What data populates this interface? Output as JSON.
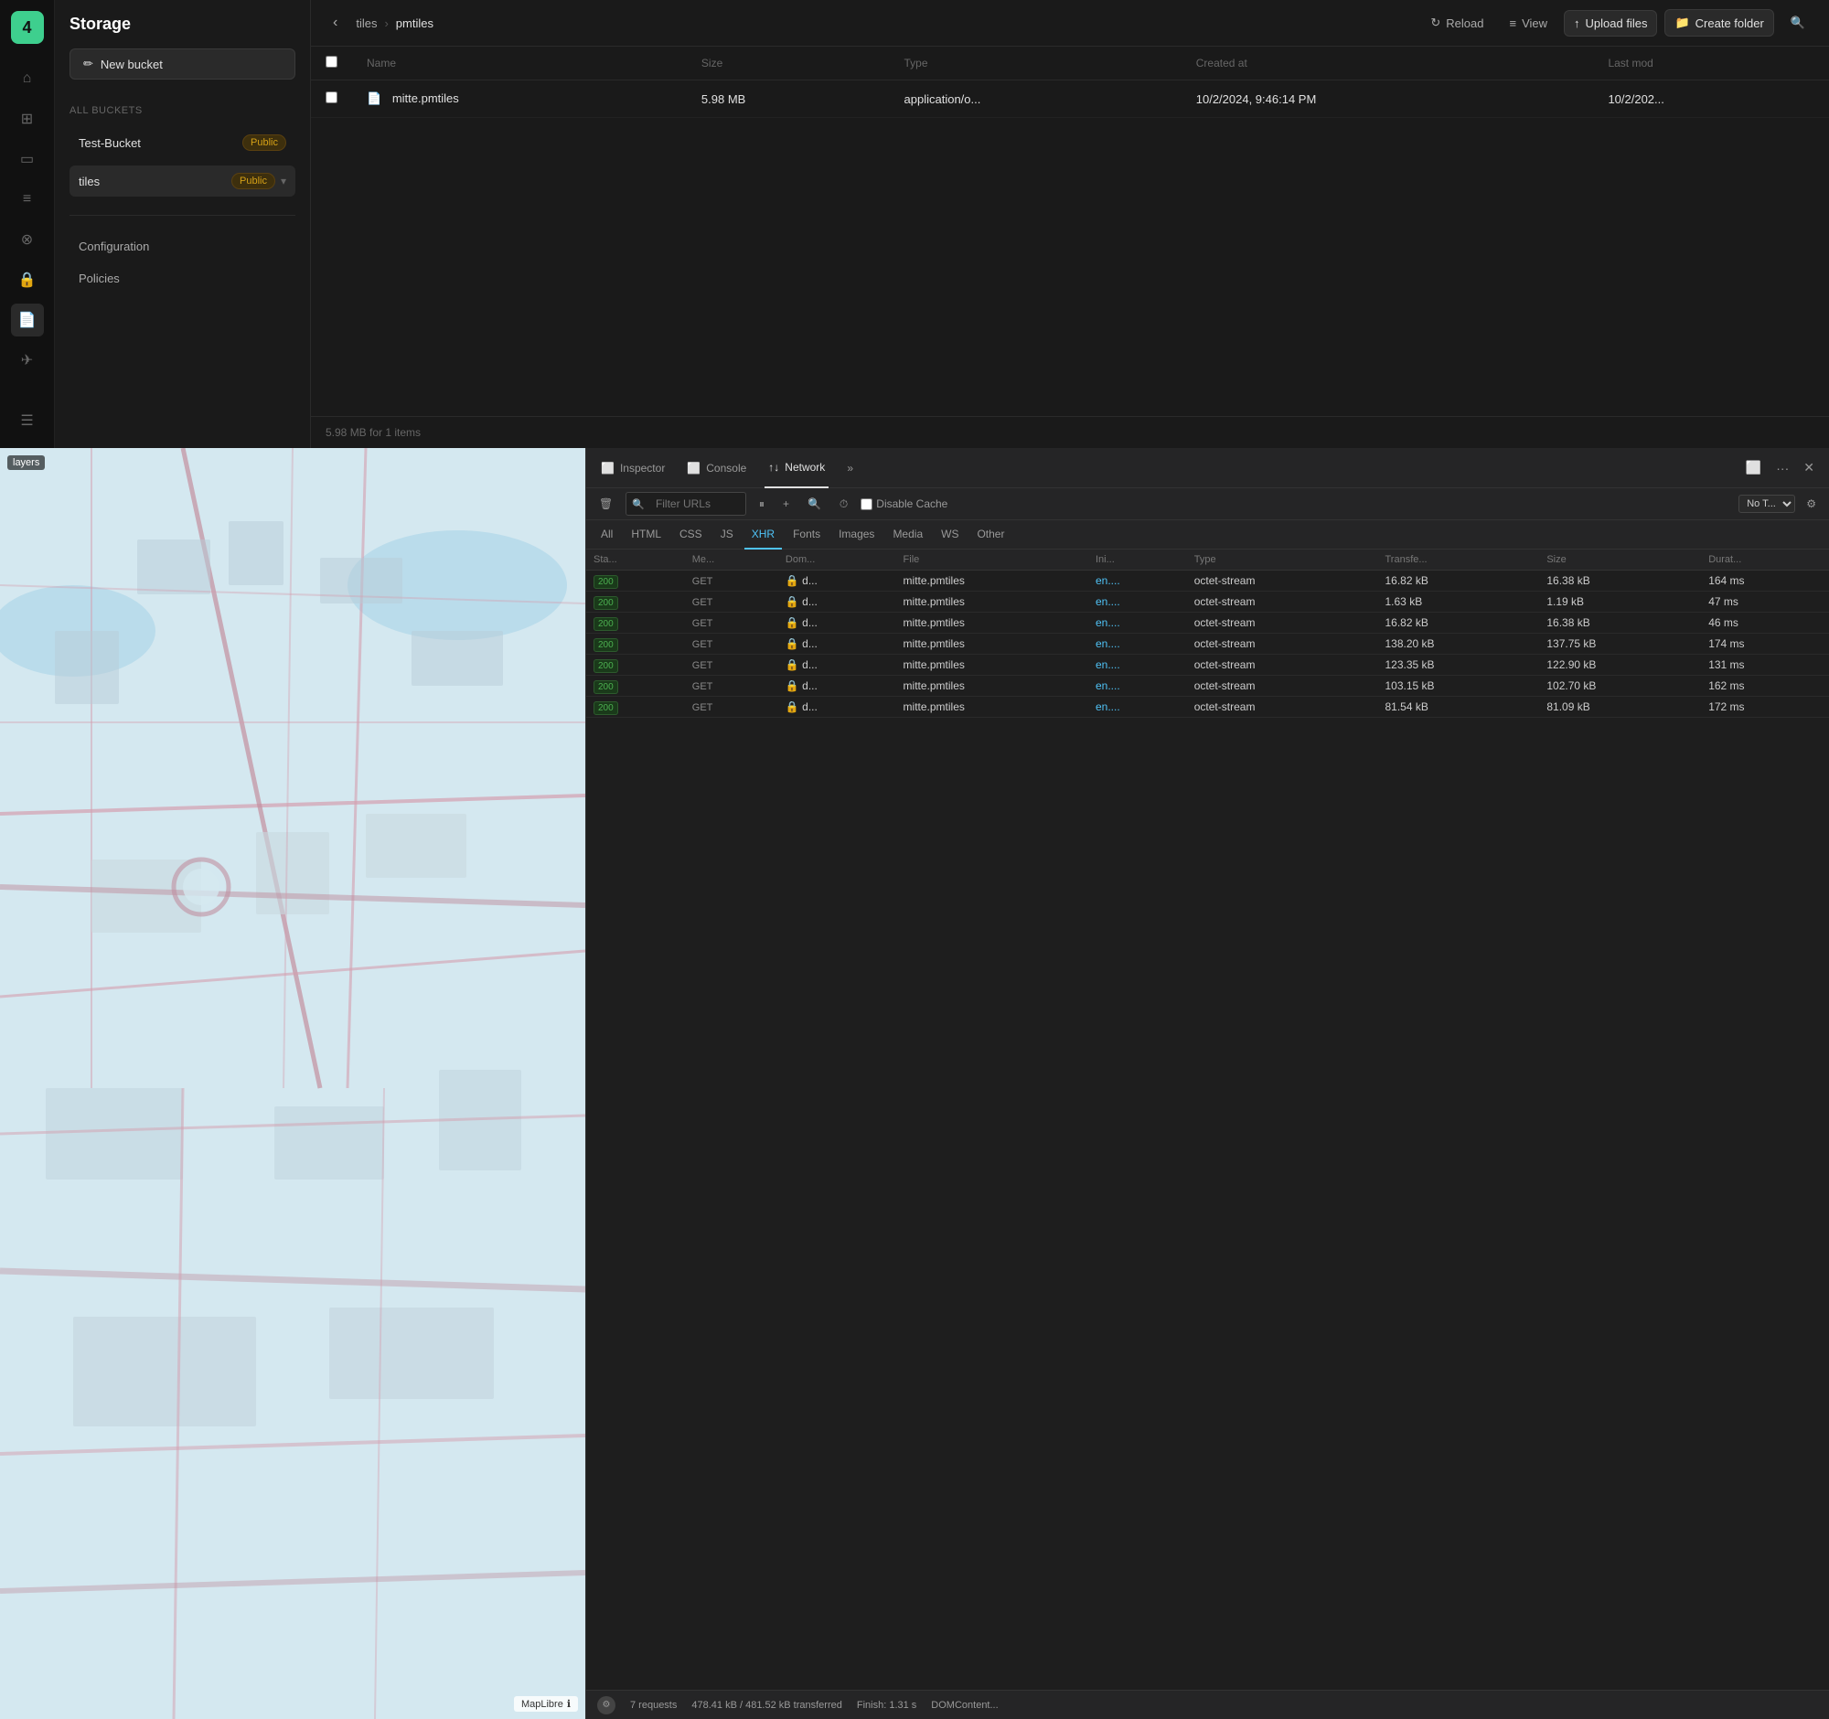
{
  "app": {
    "logo": "4",
    "title": "Storage"
  },
  "sidebar": {
    "new_bucket_label": "New bucket",
    "all_buckets_label": "All buckets",
    "buckets": [
      {
        "name": "Test-Bucket",
        "visibility": "Public"
      },
      {
        "name": "tiles",
        "visibility": "Public"
      }
    ],
    "config_label": "Configuration",
    "policies_label": "Policies"
  },
  "breadcrumb": {
    "parent": "tiles",
    "separator": "›",
    "current": "pmtiles",
    "back": "‹"
  },
  "toolbar": {
    "reload": "Reload",
    "view": "View",
    "upload": "Upload files",
    "create_folder": "Create folder",
    "search_icon": "🔍"
  },
  "file_table": {
    "columns": [
      "",
      "Name",
      "Size",
      "Type",
      "Created at",
      "Last mod"
    ],
    "rows": [
      {
        "name": "mitte.pmtiles",
        "size": "5.98 MB",
        "type": "application/o...",
        "created_at": "10/2/2024, 9:46:14 PM",
        "last_mod": "10/2/202..."
      }
    ]
  },
  "status_bar": {
    "text": "5.98 MB for 1 items"
  },
  "map": {
    "layers_label": "layers",
    "attribution": "MapLibre"
  },
  "devtools": {
    "tabs": [
      {
        "id": "inspector",
        "label": "Inspector",
        "icon": "⬜"
      },
      {
        "id": "console",
        "label": "Console",
        "icon": "⬜"
      },
      {
        "id": "network",
        "label": "Network",
        "icon": "↑↓",
        "active": true
      }
    ],
    "more_icon": "»",
    "copy_icon": "⬜",
    "menu_icon": "···",
    "close_icon": "✕"
  },
  "network_toolbar": {
    "clear_icon": "🗑",
    "filter_placeholder": "Filter URLs",
    "pause_icon": "⏸",
    "add_icon": "+",
    "search_icon": "🔍",
    "timer_icon": "⏱",
    "disable_cache": "Disable Cache",
    "throttle_label": "No T...",
    "settings_icon": "⚙"
  },
  "network_types": [
    "All",
    "HTML",
    "CSS",
    "JS",
    "XHR",
    "Fonts",
    "Images",
    "Media",
    "WS",
    "Other"
  ],
  "network_active_type": "XHR",
  "network_columns": [
    "Sta...",
    "Me...",
    "Dom...",
    "File",
    "Ini...",
    "Type",
    "Transfe...",
    "Size",
    "Durat..."
  ],
  "network_rows": [
    {
      "status": "200",
      "method": "GET",
      "domain": "🔒 d...",
      "file": "mitte.pmtiles",
      "initiator": "en....",
      "type": "octet-stream",
      "transferred": "16.82 kB",
      "size": "16.38 kB",
      "duration": "164 ms"
    },
    {
      "status": "200",
      "method": "GET",
      "domain": "🔒 d...",
      "file": "mitte.pmtiles",
      "initiator": "en....",
      "type": "octet-stream",
      "transferred": "1.63 kB",
      "size": "1.19 kB",
      "duration": "47 ms"
    },
    {
      "status": "200",
      "method": "GET",
      "domain": "🔒 d...",
      "file": "mitte.pmtiles",
      "initiator": "en....",
      "type": "octet-stream",
      "transferred": "16.82 kB",
      "size": "16.38 kB",
      "duration": "46 ms"
    },
    {
      "status": "200",
      "method": "GET",
      "domain": "🔒 d...",
      "file": "mitte.pmtiles",
      "initiator": "en....",
      "type": "octet-stream",
      "transferred": "138.20 kB",
      "size": "137.75 kB",
      "duration": "174 ms"
    },
    {
      "status": "200",
      "method": "GET",
      "domain": "🔒 d...",
      "file": "mitte.pmtiles",
      "initiator": "en....",
      "type": "octet-stream",
      "transferred": "123.35 kB",
      "size": "122.90 kB",
      "duration": "131 ms"
    },
    {
      "status": "200",
      "method": "GET",
      "domain": "🔒 d...",
      "file": "mitte.pmtiles",
      "initiator": "en....",
      "type": "octet-stream",
      "transferred": "103.15 kB",
      "size": "102.70 kB",
      "duration": "162 ms"
    },
    {
      "status": "200",
      "method": "GET",
      "domain": "🔒 d...",
      "file": "mitte.pmtiles",
      "initiator": "en....",
      "type": "octet-stream",
      "transferred": "81.54 kB",
      "size": "81.09 kB",
      "duration": "172 ms"
    }
  ],
  "devtools_footer": {
    "requests": "7 requests",
    "transferred": "478.41 kB / 481.52 kB transferred",
    "finish": "Finish: 1.31 s",
    "dom_content": "DOMContent..."
  }
}
